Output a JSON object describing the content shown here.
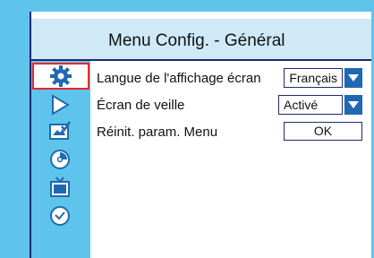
{
  "header": {
    "title": "Menu Config. - Général"
  },
  "sidebar": {
    "items": [
      {
        "icon": "gear-icon",
        "selected": true
      },
      {
        "icon": "play-icon",
        "selected": false
      },
      {
        "icon": "picture-settings-icon",
        "selected": false
      },
      {
        "icon": "disc-icon",
        "selected": false
      },
      {
        "icon": "tv-icon",
        "selected": false
      },
      {
        "icon": "clock-icon",
        "selected": false
      }
    ]
  },
  "settings": {
    "language": {
      "label": "Langue de l'affichage écran",
      "value": "Français"
    },
    "screensaver": {
      "label": "Écran de veille",
      "value": "Activé"
    },
    "reset": {
      "label": "Réinit. param. Menu",
      "button": "OK"
    }
  },
  "colors": {
    "background": "#5fc4ec",
    "header": "#cfe9f7",
    "accent": "#1f69b2",
    "selection": "#e8262d"
  }
}
